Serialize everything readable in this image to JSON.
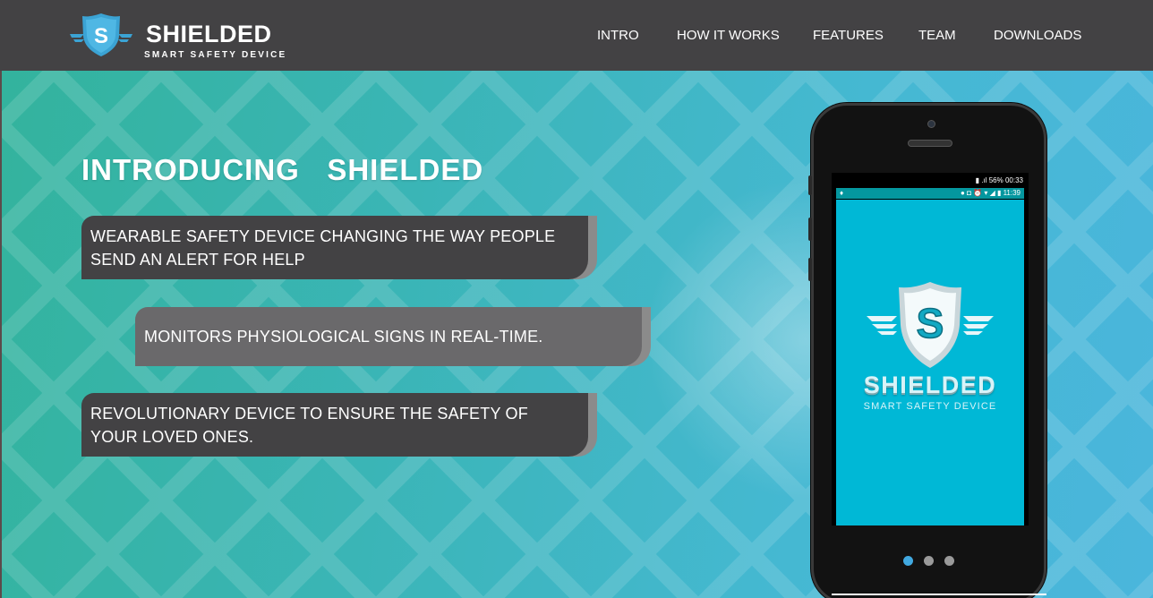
{
  "brand": {
    "title": "SHIELDED",
    "subtitle": "SMART SAFETY DEVICE",
    "logo_letter": "S"
  },
  "nav": {
    "items": [
      "INTRO",
      "HOW IT WORKS",
      "FEATURES",
      "TEAM",
      "DOWNLOADS"
    ]
  },
  "hero": {
    "title": "INTRODUCING   SHIELDED",
    "bubbles": [
      {
        "line1": "WEARABLE SAFETY DEVICE CHANGING THE WAY PEOPLE",
        "line2": "SEND AN ALERT FOR HELP"
      },
      {
        "line1": "MONITORS PHYSIOLOGICAL SIGNS IN REAL-TIME.",
        "line2": ""
      },
      {
        "line1": "REVOLUTIONARY DEVICE TO ENSURE THE SAFETY OF",
        "line2": "YOUR LOVED ONES."
      }
    ]
  },
  "phone": {
    "outer_status": "56%  00:33",
    "inner_status_time": "11:39",
    "app_title": "SHIELDED",
    "app_subtitle": "SMART SAFETY DEVICE",
    "app_logo_letter": "S"
  },
  "carousel": {
    "slides": 3,
    "active": 0
  },
  "colors": {
    "navbar": "#434244",
    "bubble_dark": "#434244",
    "bubble_mid": "#6a696b",
    "app_bg": "#00b8d6",
    "dot_active": "#41a9e0"
  }
}
